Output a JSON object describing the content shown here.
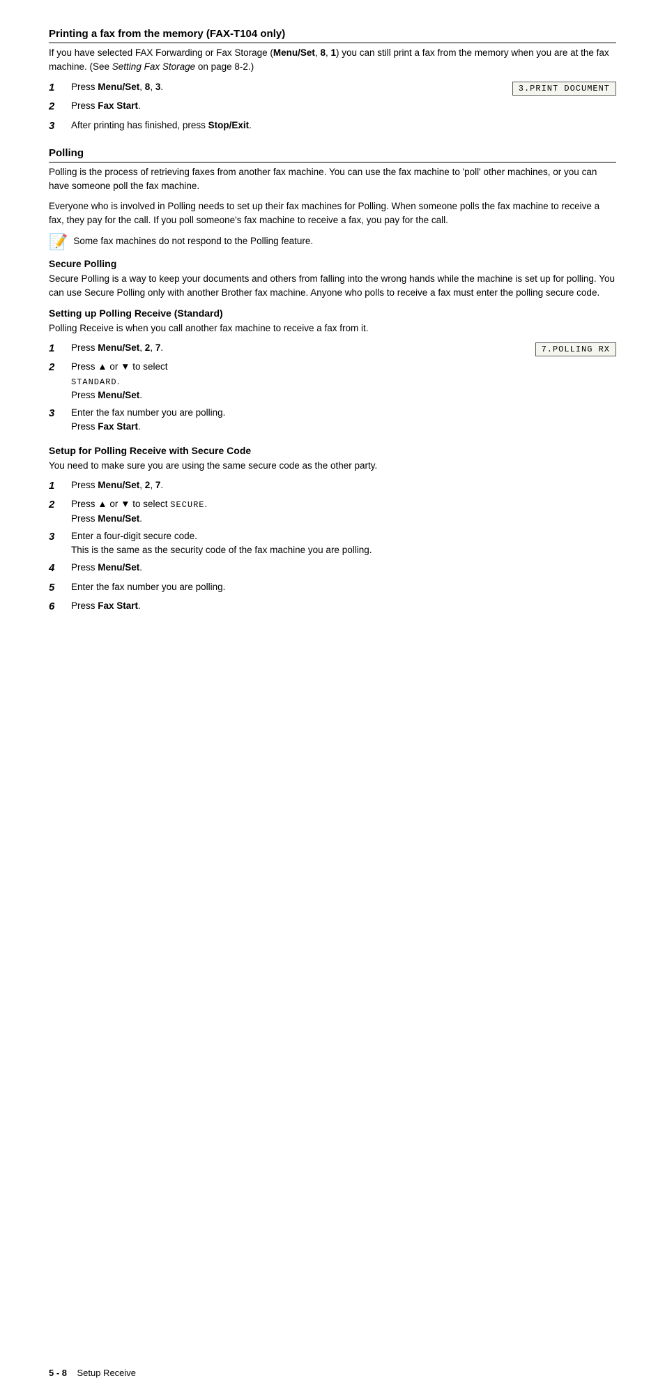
{
  "page": {
    "sections": [
      {
        "id": "printing-fax-memory",
        "title": "Printing a fax from the memory (FAX-T104 only)",
        "intro": "If you have selected FAX Forwarding or Fax Storage (",
        "intro_bold1": "Menu/Set",
        "intro2": ", ",
        "intro_bold2": "8",
        "intro3": ", ",
        "intro_bold3": "1",
        "intro4": ") you can still print a fax from the memory when you are at the fax machine. (See ",
        "intro_italic": "Setting Fax Storage",
        "intro5": " on page 8-2.)",
        "steps": [
          {
            "num": "1",
            "text": "Press ",
            "bold": "Menu/Set",
            "text2": ", ",
            "bold2": "8",
            "text3": ", ",
            "bold3": "3",
            "text4": ".",
            "lcd": "3.PRINT DOCUMENT"
          },
          {
            "num": "2",
            "text": "Press ",
            "bold": "Fax Start",
            "text2": "."
          },
          {
            "num": "3",
            "text": "After printing has finished, press ",
            "bold": "Stop/Exit",
            "text2": "."
          }
        ]
      },
      {
        "id": "polling",
        "title": "Polling",
        "paragraphs": [
          "Polling is the process of retrieving faxes from another fax machine. You can use the fax machine to 'poll' other machines, or you can have someone poll the fax machine.",
          "Everyone who is involved in Polling needs to set up their fax machines for Polling. When someone polls the fax machine to receive a fax, they pay for the call. If you poll someone's fax machine to receive a fax, you pay for the call."
        ],
        "note": "Some fax machines do not respond to the Polling feature.",
        "subsections": [
          {
            "id": "secure-polling",
            "title": "Secure Polling",
            "paragraphs": [
              "Secure Polling is a way to keep your documents and others from falling into the wrong hands while the machine is set up for polling. You can use Secure Polling only with another Brother fax machine. Anyone who polls to receive a fax must enter the polling secure code."
            ]
          },
          {
            "id": "setting-up-polling-receive",
            "title": "Setting up Polling Receive (Standard)",
            "paragraphs": [
              "Polling Receive is when you call another fax machine to receive a fax from it."
            ],
            "steps": [
              {
                "num": "1",
                "text": "Press ",
                "bold": "Menu/Set",
                "text2": ", ",
                "bold2": "2",
                "text3": ", ",
                "bold3": "7",
                "text4": ".",
                "lcd": "7.POLLING RX"
              },
              {
                "num": "2",
                "lines": [
                  {
                    "text": "Press ",
                    "sym": "▲",
                    "text2": " or ",
                    "sym2": "▼",
                    "text3": " to select"
                  },
                  {
                    "mono": "STANDARD",
                    "text": "."
                  },
                  {
                    "text": "Press ",
                    "bold": "Menu/Set",
                    "text2": "."
                  }
                ]
              },
              {
                "num": "3",
                "lines": [
                  {
                    "text": "Enter the fax number you are polling."
                  },
                  {
                    "text": "Press ",
                    "bold": "Fax Start",
                    "text2": "."
                  }
                ]
              }
            ]
          },
          {
            "id": "setup-polling-secure-code",
            "title": "Setup for Polling Receive with Secure Code",
            "paragraphs": [
              "You need to make sure you are using the same secure code as the other party."
            ],
            "steps": [
              {
                "num": "1",
                "text": "Press ",
                "bold": "Menu/Set",
                "text2": ", ",
                "bold2": "2",
                "text3": ", ",
                "bold3": "7",
                "text4": "."
              },
              {
                "num": "2",
                "lines": [
                  {
                    "text": "Press ",
                    "sym": "▲",
                    "text2": " or ",
                    "sym2": "▼",
                    "text3": " to select ",
                    "mono": "SECURE",
                    "text4": "."
                  },
                  {
                    "text": "Press ",
                    "bold": "Menu/Set",
                    "text2": "."
                  }
                ]
              },
              {
                "num": "3",
                "lines": [
                  {
                    "text": "Enter a four-digit secure code."
                  },
                  {
                    "text": "This is the same as the security code of the fax machine you are polling."
                  }
                ]
              },
              {
                "num": "4",
                "text": "Press ",
                "bold": "Menu/Set",
                "text2": "."
              },
              {
                "num": "5",
                "text": "Enter the fax number you are polling."
              },
              {
                "num": "6",
                "text": "Press ",
                "bold": "Fax Start",
                "text2": "."
              }
            ]
          }
        ]
      }
    ],
    "footer": {
      "page_ref": "5 - 8",
      "label": "Setup Receive"
    }
  }
}
